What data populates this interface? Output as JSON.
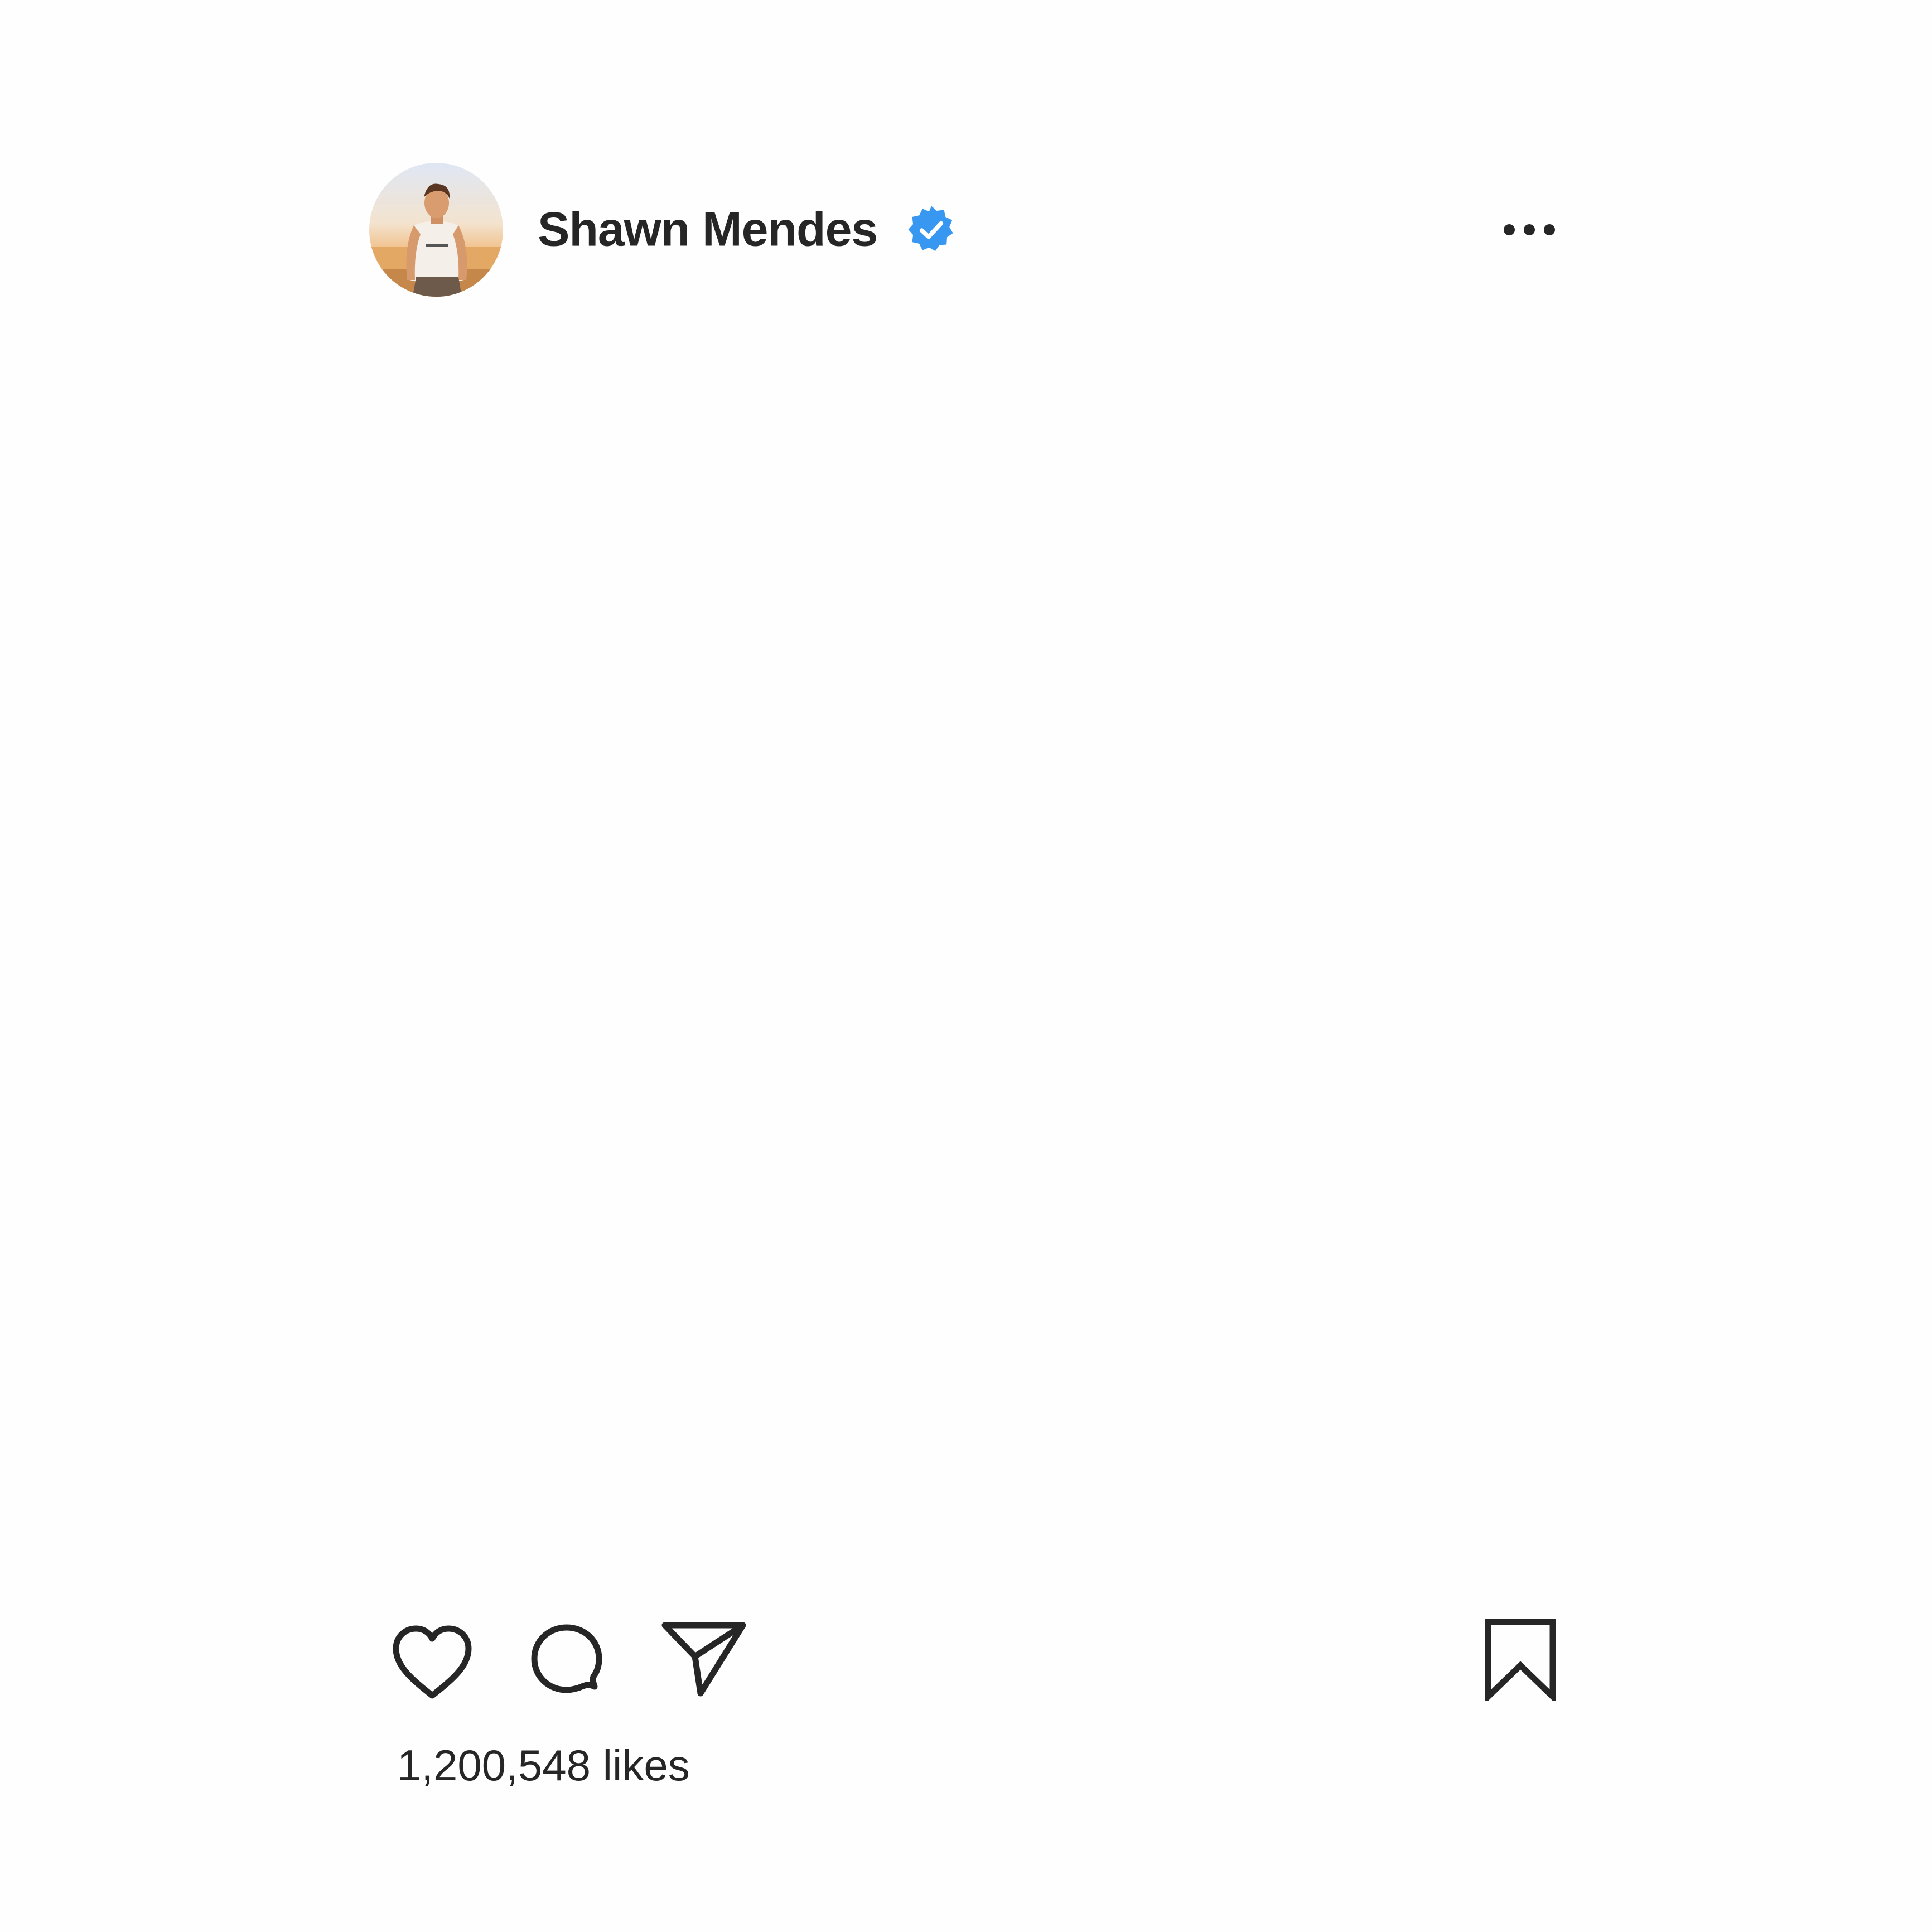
{
  "post": {
    "username": "Shawn Mendes",
    "verified": true,
    "likes_text": "1,200,548 likes"
  },
  "icons": {
    "avatar": "profile-photo",
    "verified": "verified-badge-icon",
    "more": "more-options-icon",
    "like": "heart-icon",
    "comment": "comment-bubble-icon",
    "share": "paper-plane-icon",
    "save": "bookmark-icon"
  },
  "colors": {
    "text": "#262626",
    "verified_blue": "#3897f0",
    "background": "#fefefe"
  }
}
